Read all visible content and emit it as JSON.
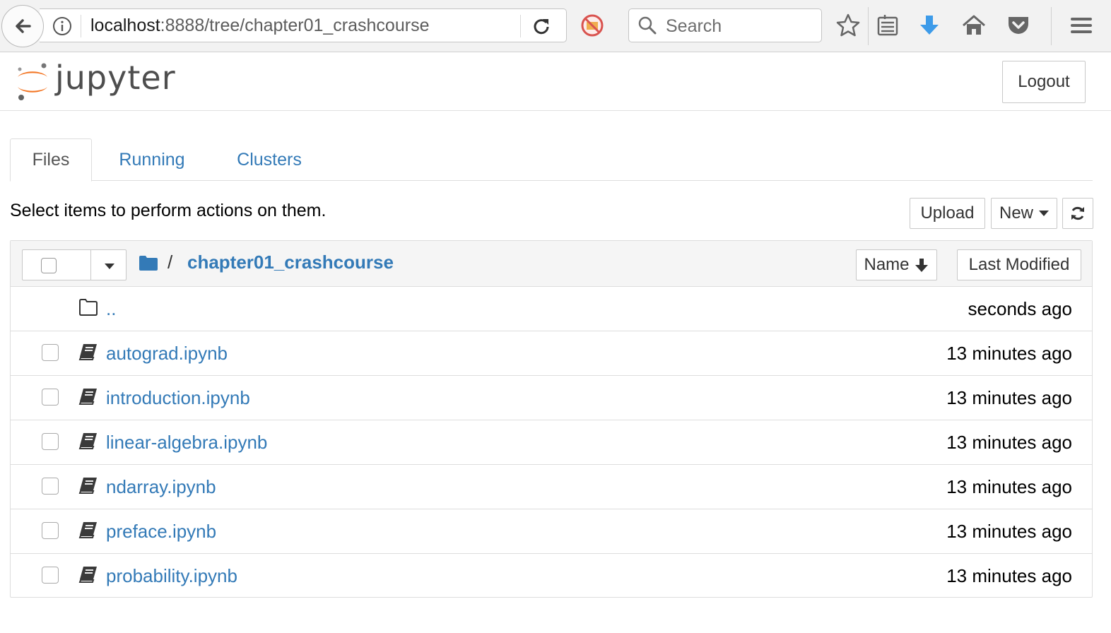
{
  "browser": {
    "url_host": "localhost",
    "url_path": ":8888/tree/chapter01_crashcourse",
    "search_placeholder": "Search"
  },
  "header": {
    "logo_text": "jupyter",
    "logout_label": "Logout"
  },
  "tabs": [
    {
      "label": "Files",
      "active": true
    },
    {
      "label": "Running",
      "active": false
    },
    {
      "label": "Clusters",
      "active": false
    }
  ],
  "actions": {
    "hint": "Select items to perform actions on them.",
    "upload_label": "Upload",
    "new_label": "New"
  },
  "list_header": {
    "separator": "/",
    "current_dir": "chapter01_crashcourse",
    "sort_name_label": "Name",
    "sort_modified_label": "Last Modified"
  },
  "rows": [
    {
      "name": "..",
      "modified": "seconds ago",
      "type": "parent"
    },
    {
      "name": "autograd.ipynb",
      "modified": "13 minutes ago",
      "type": "notebook"
    },
    {
      "name": "introduction.ipynb",
      "modified": "13 minutes ago",
      "type": "notebook"
    },
    {
      "name": "linear-algebra.ipynb",
      "modified": "13 minutes ago",
      "type": "notebook"
    },
    {
      "name": "ndarray.ipynb",
      "modified": "13 minutes ago",
      "type": "notebook"
    },
    {
      "name": "preface.ipynb",
      "modified": "13 minutes ago",
      "type": "notebook"
    },
    {
      "name": "probability.ipynb",
      "modified": "13 minutes ago",
      "type": "notebook"
    }
  ],
  "colors": {
    "link": "#337ab7",
    "jupyter_orange": "#f37726"
  }
}
